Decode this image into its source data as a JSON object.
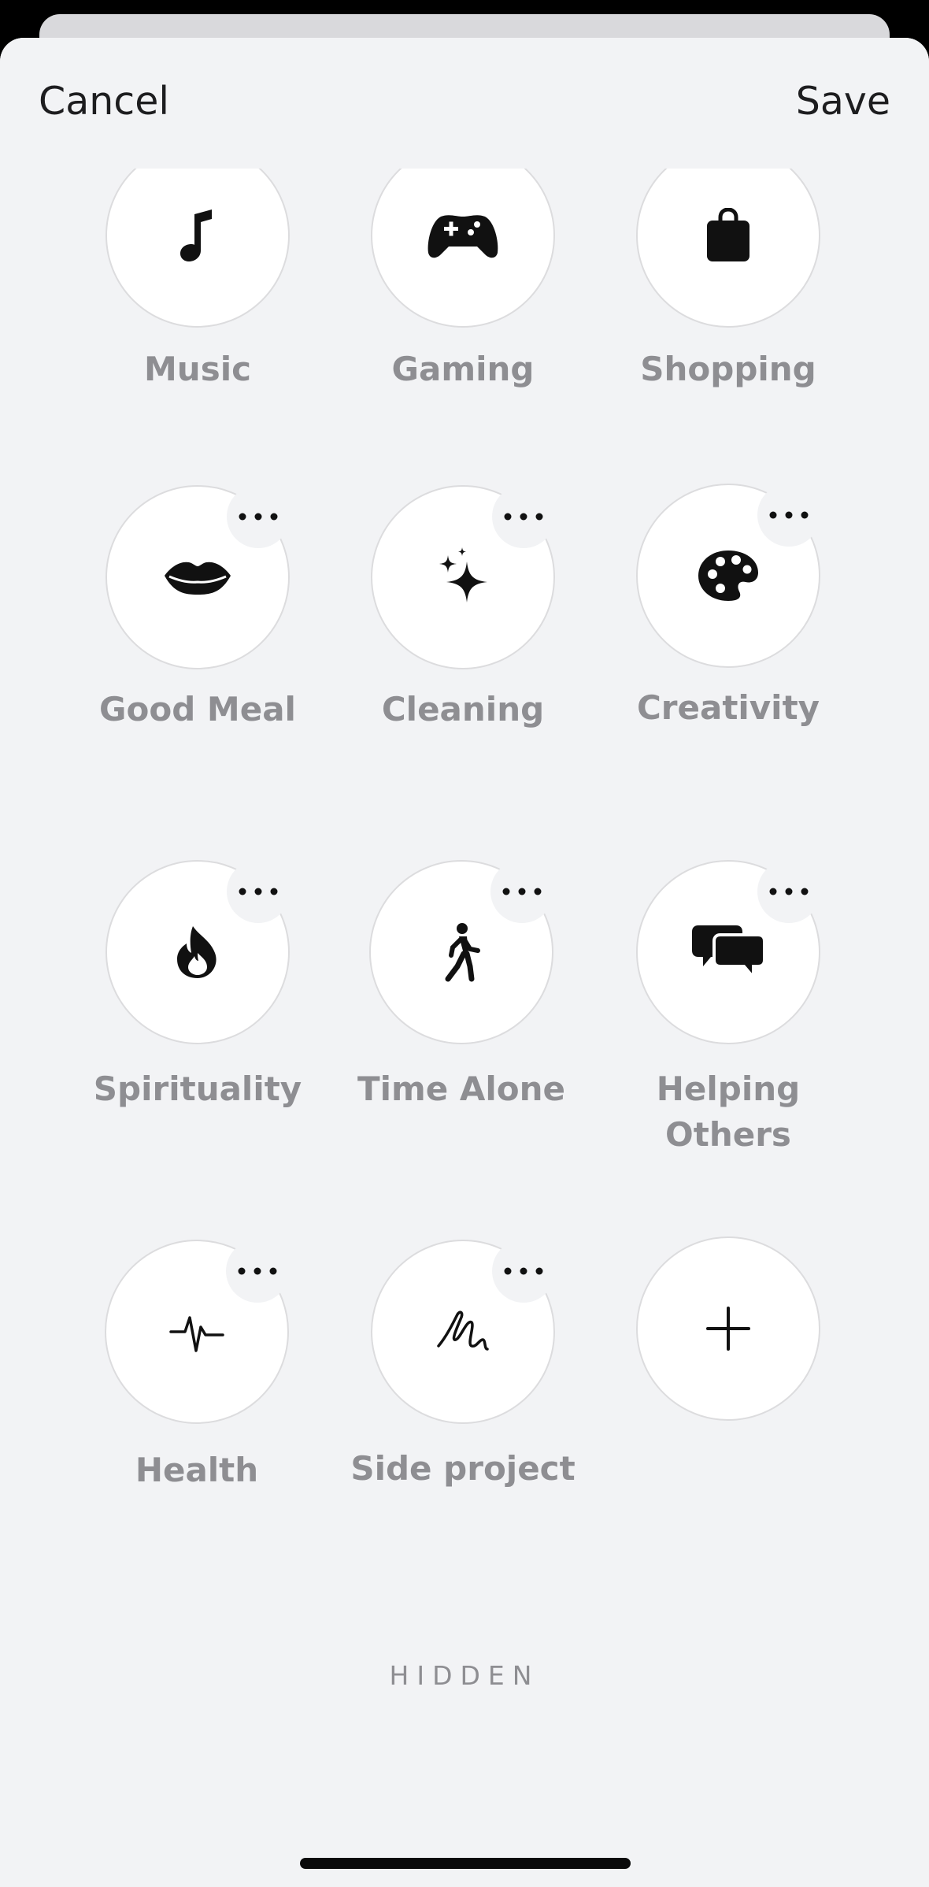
{
  "nav": {
    "cancel_label": "Cancel",
    "save_label": "Save"
  },
  "activities": [
    {
      "label": "Music",
      "icon": "music-note-icon"
    },
    {
      "label": "Gaming",
      "icon": "gamepad-icon"
    },
    {
      "label": "Shopping",
      "icon": "shopping-bag-icon"
    },
    {
      "label": "Good Meal",
      "icon": "lips-icon"
    },
    {
      "label": "Cleaning",
      "icon": "sparkles-icon"
    },
    {
      "label": "Creativity",
      "icon": "palette-icon"
    },
    {
      "label": "Spirituality",
      "icon": "flame-icon"
    },
    {
      "label": "Time Alone",
      "icon": "walking-person-icon"
    },
    {
      "label": "Helping Others",
      "icon": "chat-bubbles-icon"
    },
    {
      "label": "Health",
      "icon": "heartbeat-icon"
    },
    {
      "label": "Side project",
      "icon": "scribble-icon"
    }
  ],
  "add_button": {
    "icon": "plus-icon"
  },
  "hidden_section": {
    "title": "HIDDEN"
  },
  "colors": {
    "background": "#f2f3f5",
    "label_gray": "#8e8e92",
    "icon": "#111111"
  }
}
